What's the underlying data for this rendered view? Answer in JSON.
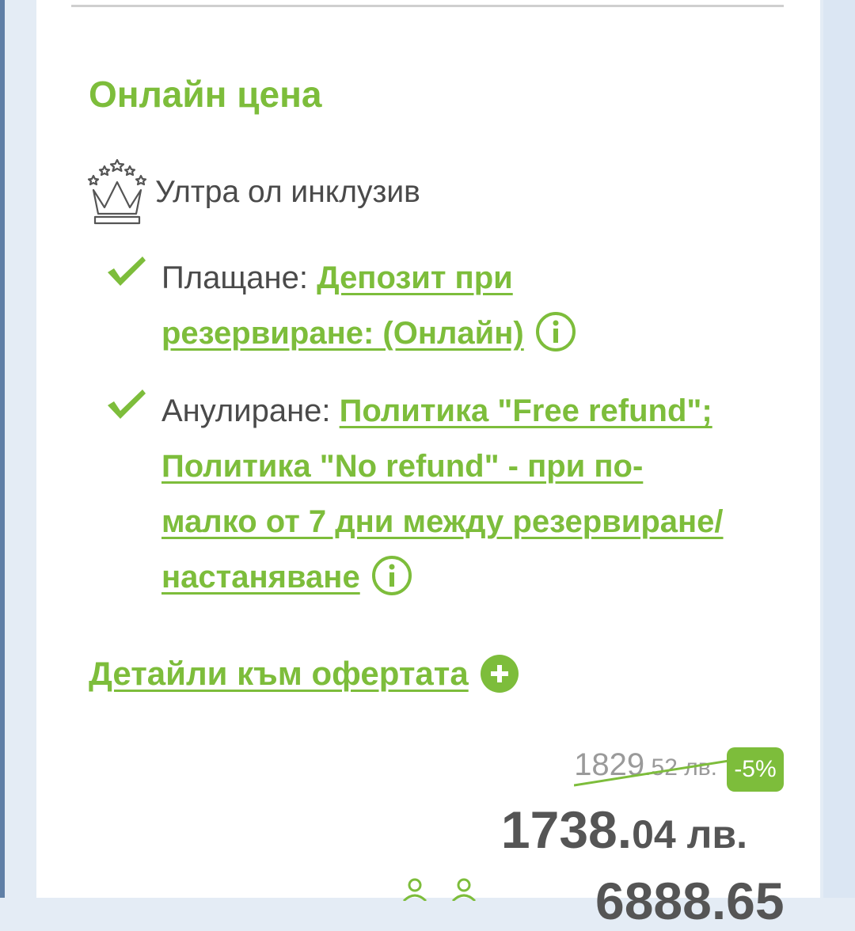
{
  "offer": {
    "section_title": "Онлайн цена",
    "board": {
      "label": "Ултра ол инклузив",
      "icon": "crown-stars-icon"
    },
    "payment": {
      "label": "Плащане:",
      "link_text": "Депозит при резервиране: (Онлайн)"
    },
    "cancellation": {
      "label": "Анулиране:",
      "link_text": "Политика \"Free refund\"; Политика \"No refund\" - при по-малко от 7 дни между резервиране/настаняване"
    },
    "details_link": "Детайли към офертата",
    "price": {
      "old_main": "1829",
      "old_cents": ".52 лв.",
      "discount": "-5%",
      "new_main": "1738.",
      "new_cents": "04 лв.",
      "total_partial": "6888.65"
    },
    "colors": {
      "accent": "#7dbd3b",
      "text": "#4a4a4a",
      "muted": "#9a9a9a"
    }
  }
}
